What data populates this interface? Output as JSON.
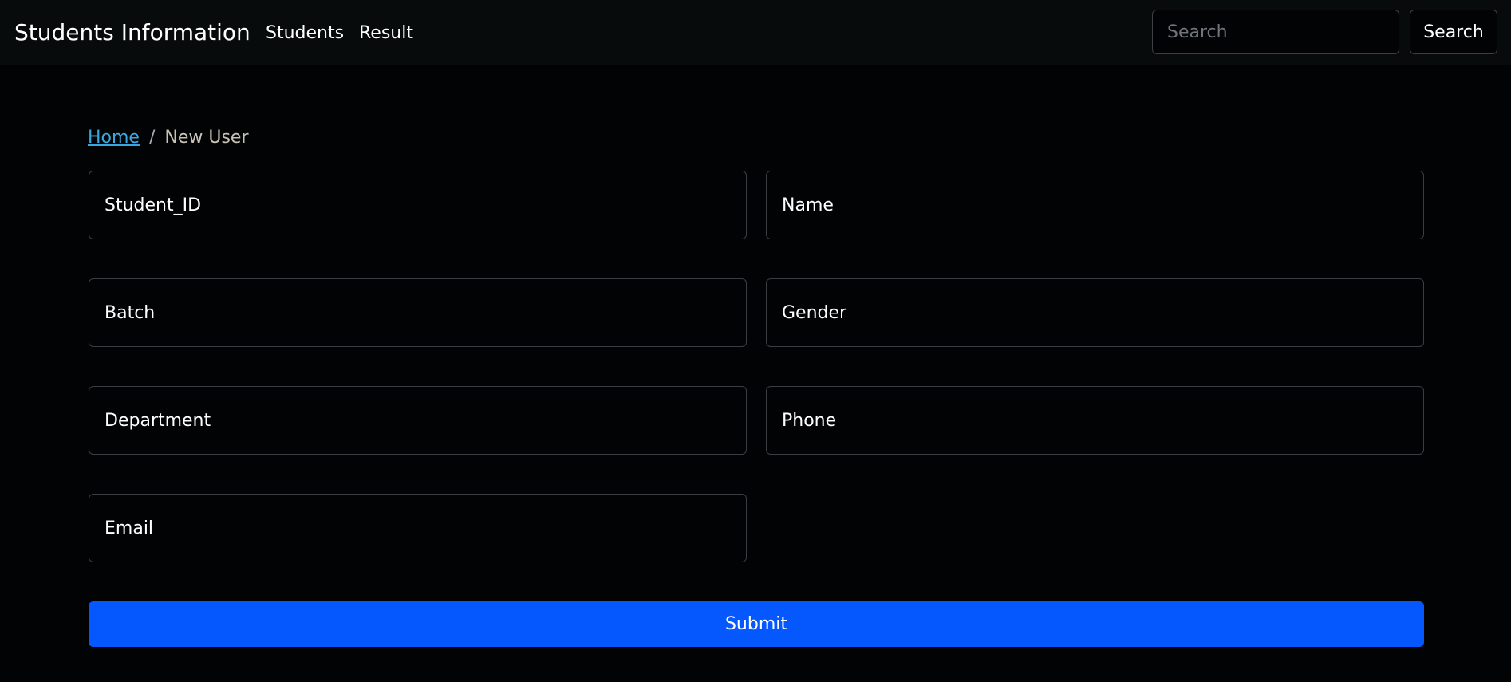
{
  "navbar": {
    "brand": "Students Information",
    "links": [
      {
        "label": "Students"
      },
      {
        "label": "Result"
      }
    ],
    "search": {
      "placeholder": "Search",
      "value": "",
      "button_label": "Search"
    }
  },
  "breadcrumb": {
    "home": "Home",
    "separator": "/",
    "current": "New User"
  },
  "form": {
    "fields": {
      "student_id": {
        "placeholder": "Student_ID",
        "value": ""
      },
      "name": {
        "placeholder": "Name",
        "value": ""
      },
      "batch": {
        "placeholder": "Batch",
        "value": ""
      },
      "gender": {
        "placeholder": "Gender",
        "value": ""
      },
      "department": {
        "placeholder": "Department",
        "value": ""
      },
      "phone": {
        "placeholder": "Phone",
        "value": ""
      },
      "email": {
        "placeholder": "Email",
        "value": ""
      }
    },
    "submit_label": "Submit"
  },
  "colors": {
    "background": "#020304",
    "navbar": "#070b0c",
    "accent": "#0458fd",
    "link": "#3aa8e0"
  }
}
